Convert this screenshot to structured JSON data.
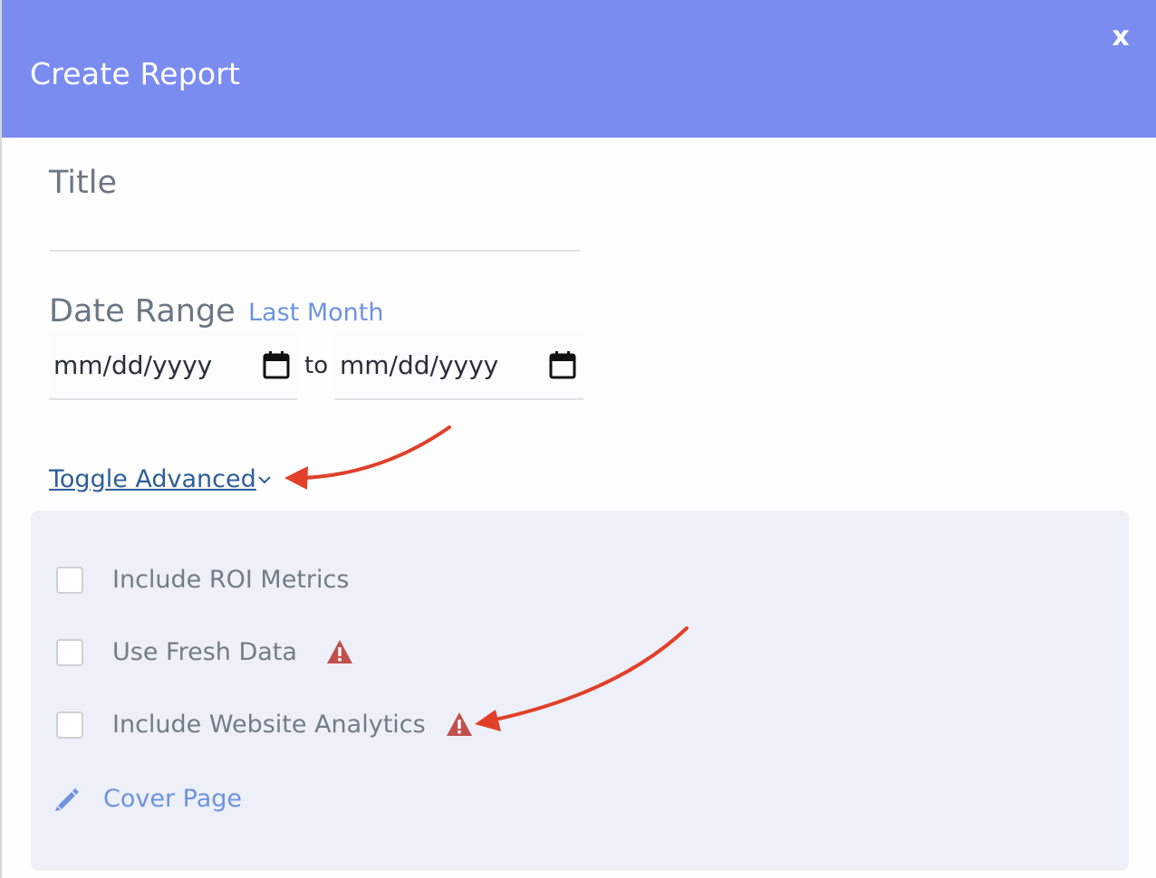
{
  "dialog": {
    "title": "Create Report",
    "close_label": "x"
  },
  "form": {
    "title_label": "Title",
    "title_value": "",
    "date_range_label": "Date Range",
    "last_month_label": "Last Month",
    "from_date_placeholder": "mm/dd/yyyy",
    "to_label": "to",
    "to_date_placeholder": "mm/dd/yyyy",
    "toggle_advanced_label": "Toggle Advanced"
  },
  "advanced": {
    "options": [
      {
        "label": "Include ROI Metrics",
        "checked": false,
        "warning": false
      },
      {
        "label": "Use Fresh Data",
        "checked": false,
        "warning": true
      },
      {
        "label": "Include Website Analytics",
        "checked": false,
        "warning": true
      }
    ],
    "cover_page_label": "Cover Page"
  },
  "icons": {
    "close": "close-icon",
    "calendar": "calendar-icon",
    "chevron": "chevron-down-icon",
    "warning": "warning-icon",
    "pencil": "pencil-icon",
    "annotation_arrow": "red-arrow"
  },
  "colors": {
    "header_bg": "#7a8cf0",
    "link": "#6e93df",
    "toggle_link": "#2d5e98",
    "warning": "#c0504d",
    "annotation": "#e0402a",
    "panel_bg": "#edf0f8"
  }
}
